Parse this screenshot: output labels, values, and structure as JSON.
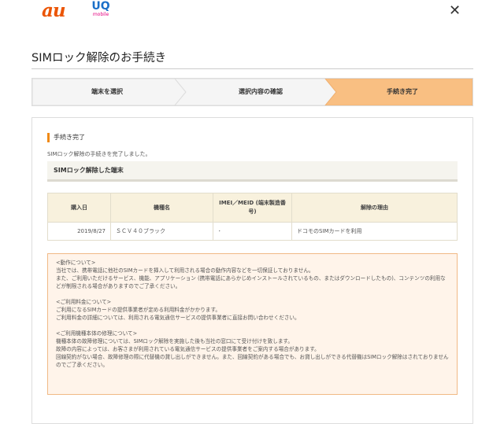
{
  "header": {
    "logo_au": "au",
    "logo_uq": "UQ",
    "logo_uq_sub": "mobile",
    "close": "✕"
  },
  "page_title": "SIMロック解除のお手続き",
  "steps": [
    {
      "label": "端末を選択",
      "active": false
    },
    {
      "label": "選択内容の確認",
      "active": false
    },
    {
      "label": "手続き完了",
      "active": true
    }
  ],
  "colors": {
    "active_step": "#f9bf82",
    "inactive_step": "#f5f5f5",
    "accent": "#f08a16",
    "au_brand": "#eb5505",
    "uq_brand": "#1b6fc8"
  },
  "section": {
    "heading": "手続き完了",
    "message": "SIMロック解除の手続きを完了しました。",
    "sub_heading": "SIMロック解除した端末"
  },
  "table": {
    "headers": [
      "購入日",
      "機種名",
      "IMEI／MEID (端末製造番号)",
      "解除の理由"
    ],
    "rows": [
      {
        "date": "2019/8/27",
        "model": "ＳＣＶ４０ブラック",
        "imei": "･",
        "reason": "ドコモのSIMカードを利用"
      }
    ]
  },
  "notice": {
    "operation_title": "<動作について>",
    "operation_1": "当社では、携帯電話に他社のSIMカードを挿入して利用される場合の動作内容などを一切保証しておりません。",
    "operation_2": "また、ご利用いただけるサービス、機能、アプリケーション (携帯電話にあらかじめインストールされているもの、またはダウンロードしたもの)、コンテンツの利用などが制限される場合がありますのでご了承ください。",
    "fee_title": "<ご利用料金について>",
    "fee_1": "ご利用になるSIMカードの提供事業者が定める利用料金がかかります。",
    "fee_2": "ご利用料金の詳細については、利用される電気通信サービスの提供事業者に直接お問い合わせください。",
    "repair_title": "<ご利用機種本体の修理について>",
    "repair_1": "機種本体の故障修理については、SIMロック解除を実施した後も当社の窓口にて受け付けを致します。",
    "repair_2": "故障の内容によっては、お客さまが利用されている電気通信サービスの提供事業者をご案内する場合があります。",
    "repair_3": "回線契約がない場合、故障修理の際に代替機の貸し出しができません。また、回線契約がある場合でも、お貸し出しができる代替機はSIMロック解除はされておりませんのでご了承ください。"
  }
}
